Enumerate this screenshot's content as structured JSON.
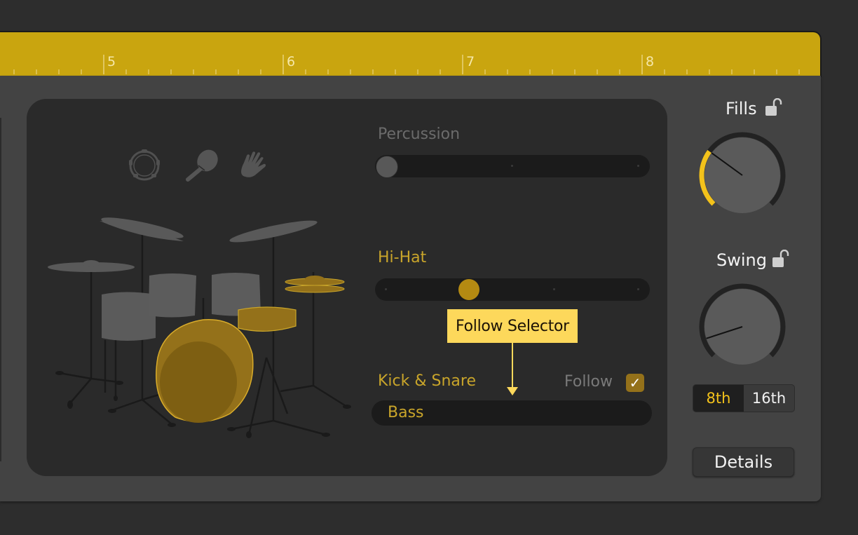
{
  "ruler": {
    "bars": [
      {
        "label": "5"
      },
      {
        "label": "6"
      },
      {
        "label": "7"
      },
      {
        "label": "8"
      }
    ],
    "color": "#c9a50f"
  },
  "percussion_instruments": [
    {
      "name": "tambourine",
      "icon": "tambourine-icon"
    },
    {
      "name": "shaker",
      "icon": "maraca-icon"
    },
    {
      "name": "clap",
      "icon": "hand-icon"
    }
  ],
  "drum_kit": {
    "highlighted": [
      "kick",
      "snare",
      "hi-hat"
    ],
    "highlight_color": "#94711a"
  },
  "percussion": {
    "label": "Percussion",
    "value": 0,
    "active": false
  },
  "hihat": {
    "label": "Hi-Hat",
    "value": 0.33,
    "active": true
  },
  "kick_snare": {
    "label": "Kick & Snare",
    "follow_label": "Follow",
    "follow_checked": true,
    "check_glyph": "✓",
    "selector_value": "Bass"
  },
  "annotation": {
    "text": "Follow Selector",
    "color": "#fdd85b"
  },
  "fills": {
    "label": "Fills",
    "value": 0.3,
    "locked": false
  },
  "swing": {
    "label": "Swing",
    "value": 0.1,
    "locked": false,
    "options": [
      "8th",
      "16th"
    ],
    "selected": "8th"
  },
  "details_label": "Details",
  "colors": {
    "accent": "#f3c21b",
    "active_label": "#c9a52a",
    "inactive_label": "#6b6b6b"
  }
}
